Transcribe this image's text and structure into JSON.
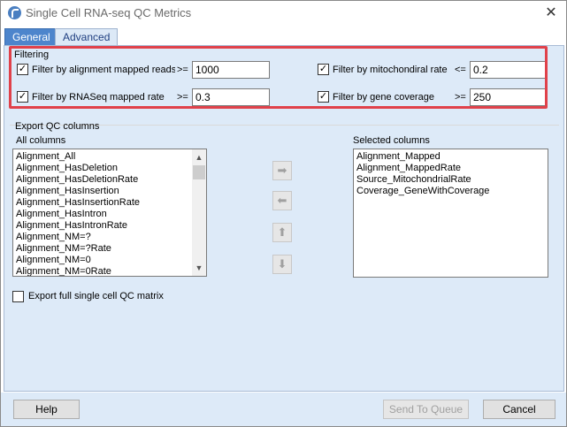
{
  "window": {
    "title": "Single Cell RNA-seq QC Metrics",
    "close_glyph": "✕"
  },
  "tabs": [
    {
      "label": "General"
    },
    {
      "label": "Advanced"
    }
  ],
  "filtering": {
    "legend": "Filtering",
    "rows": [
      {
        "label": "Filter by alignment mapped reads",
        "checked": "✓",
        "op": ">=",
        "value": "1000"
      },
      {
        "label": "Filter by mitochondiral rate",
        "checked": "✓",
        "op": "<=",
        "value": "0.2"
      },
      {
        "label": "Filter by RNASeq mapped rate",
        "checked": "✓",
        "op": ">=",
        "value": "0.3"
      },
      {
        "label": "Filter by gene coverage",
        "checked": "✓",
        "op": ">=",
        "value": "250"
      }
    ]
  },
  "export": {
    "legend": "Export QC columns",
    "all_columns_label": "All columns",
    "selected_columns_label": "Selected columns",
    "all_columns": [
      "Alignment_All",
      "Alignment_HasDeletion",
      "Alignment_HasDeletionRate",
      "Alignment_HasInsertion",
      "Alignment_HasInsertionRate",
      "Alignment_HasIntron",
      "Alignment_HasIntronRate",
      "Alignment_NM=?",
      "Alignment_NM=?Rate",
      "Alignment_NM=0",
      "Alignment_NM=0Rate"
    ],
    "selected_columns": [
      "Alignment_Mapped",
      "Alignment_MappedRate",
      "Source_MitochondrialRate",
      "Coverage_GeneWithCoverage"
    ],
    "move_glyphs": {
      "right": "➡",
      "left": "⬅",
      "up": "⬆",
      "down": "⬇"
    },
    "scroll_glyphs": {
      "up": "▲",
      "down": "▼"
    },
    "full_matrix_label": "Export full single cell QC matrix"
  },
  "footer": {
    "help_label": "Help",
    "send_label": "Send To Queue",
    "cancel_label": "Cancel"
  },
  "colors": {
    "accent": "#4d85cc",
    "highlight": "#e0414a",
    "panel": "#ddeaf8"
  }
}
